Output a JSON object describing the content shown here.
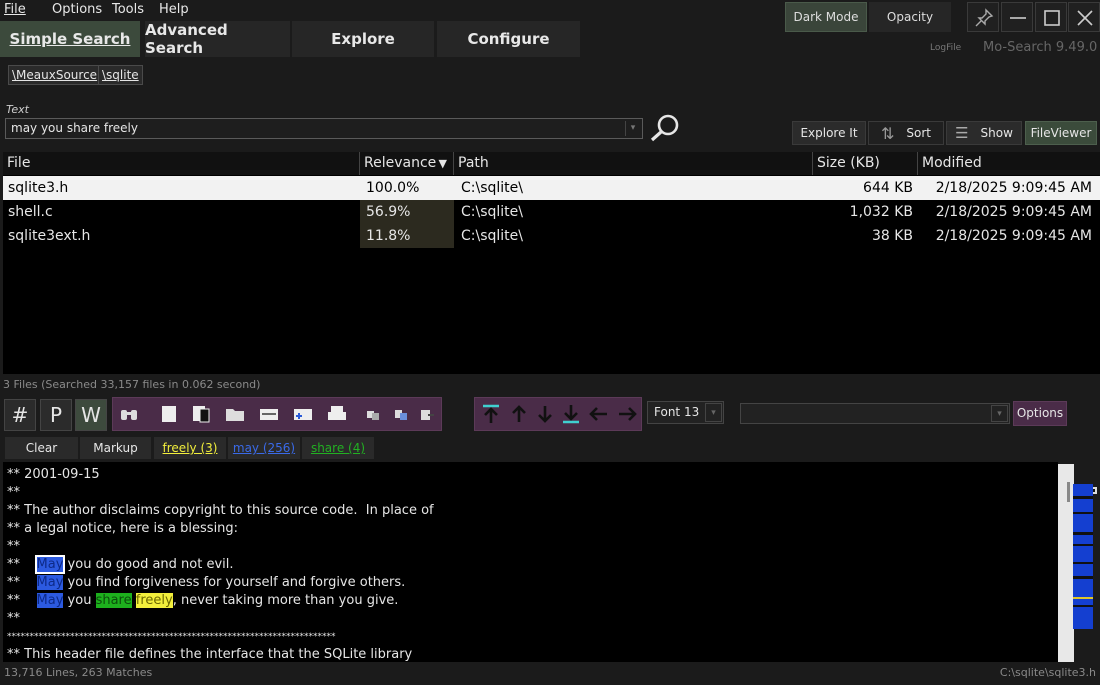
{
  "menu": {
    "file": "File",
    "options": "Options",
    "tools": "Tools",
    "help": "Help"
  },
  "tabs": {
    "simple": "Simple Search",
    "advanced": "Advanced Search",
    "explore": "Explore",
    "configure": "Configure"
  },
  "topright": {
    "dark_mode": "Dark Mode",
    "opacity": "Opacity",
    "logfile": "LogFile",
    "app_version": "Mo-Search 9.49.0"
  },
  "breadcrumb": {
    "item1": "\\MeauxSource",
    "item2": "\\sqlite"
  },
  "search": {
    "label": "Text",
    "value": "may you share freely"
  },
  "toolbar": {
    "explore_it": "Explore It",
    "sort": "Sort",
    "show": "Show",
    "fileviewer": "FileViewer"
  },
  "table": {
    "headers": {
      "file": "File",
      "relevance": "Relevance",
      "path": "Path",
      "size": "Size (KB)",
      "modified": "Modified"
    },
    "rows": [
      {
        "file": "sqlite3.h",
        "relevance": "100.0%",
        "path": "C:\\sqlite\\",
        "size": "644 KB",
        "modified": "2/18/2025 9:09:45 AM"
      },
      {
        "file": "shell.c",
        "relevance": "56.9%",
        "path": "C:\\sqlite\\",
        "size": "1,032 KB",
        "modified": "2/18/2025 9:09:45 AM"
      },
      {
        "file": "sqlite3ext.h",
        "relevance": "11.8%",
        "path": "C:\\sqlite\\",
        "size": "38 KB",
        "modified": "2/18/2025 9:09:45 AM"
      }
    ]
  },
  "status_top": "3 Files  (Searched 33,157 files in 0.062 second)",
  "viewer": {
    "hash": "#",
    "p": "P",
    "w": "W",
    "font_label": "Font 13",
    "options_label": "Options",
    "clear_label": "Clear",
    "markup_label": "Markup",
    "term1": "freely (3)",
    "term2": "may (256)",
    "term3": "share (4)",
    "colors": {
      "freely": "#f2ef3c",
      "may": "#2c5ae0",
      "share": "#1db01d"
    }
  },
  "editor": {
    "l1": "** 2001-09-15",
    "l2": "**",
    "l3": "** The author disclaims copyright to this source code.  In place of",
    "l4": "** a legal notice, here is a blessing:",
    "l5": "**",
    "l6a": "**    ",
    "l6may": "May",
    "l6b": " you do good and not evil.",
    "l7a": "**    ",
    "l7may": "May",
    "l7b": " you find forgiveness for yourself and forgive others.",
    "l8a": "**    ",
    "l8may": "May",
    "l8mid": " you ",
    "l8share": "share",
    "l8sp": " ",
    "l8freely": "freely",
    "l8b": ", never taking more than you give.",
    "l9": "**",
    "l10": "*************************************************************************",
    "l11": "** This header file defines the interface that the SQLite library"
  },
  "status_bottom": {
    "left": "13,716 Lines, 263 Matches",
    "right": "C:\\sqlite\\sqlite3.h"
  }
}
